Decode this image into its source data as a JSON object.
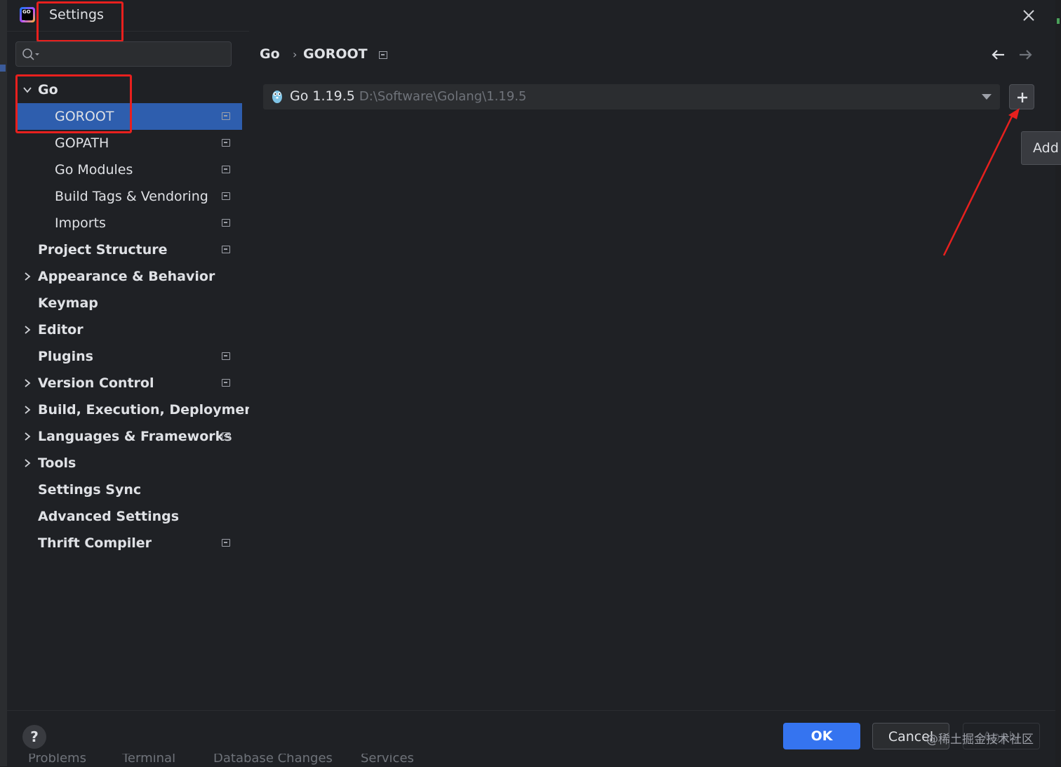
{
  "window": {
    "title": "Settings"
  },
  "search": {
    "placeholder": ""
  },
  "tree": {
    "items": [
      {
        "label": "Go",
        "level": 1,
        "expanded": true,
        "project_icon": false
      },
      {
        "label": "GOROOT",
        "level": 2,
        "selected": true,
        "project_icon": true
      },
      {
        "label": "GOPATH",
        "level": 2,
        "project_icon": true
      },
      {
        "label": "Go Modules",
        "level": 2,
        "project_icon": true
      },
      {
        "label": "Build Tags & Vendoring",
        "level": 2,
        "project_icon": true
      },
      {
        "label": "Imports",
        "level": 2,
        "project_icon": true
      },
      {
        "label": "Project Structure",
        "level": 1,
        "project_icon": true
      },
      {
        "label": "Appearance & Behavior",
        "level": 1,
        "collapsed": true
      },
      {
        "label": "Keymap",
        "level": 1
      },
      {
        "label": "Editor",
        "level": 1,
        "collapsed": true
      },
      {
        "label": "Plugins",
        "level": 1,
        "project_icon": true
      },
      {
        "label": "Version Control",
        "level": 1,
        "collapsed": true,
        "project_icon": true
      },
      {
        "label": "Build, Execution, Deployment",
        "level": 1,
        "collapsed": true
      },
      {
        "label": "Languages & Frameworks",
        "level": 1,
        "collapsed": true,
        "project_icon": true
      },
      {
        "label": "Tools",
        "level": 1,
        "collapsed": true
      },
      {
        "label": "Settings Sync",
        "level": 1
      },
      {
        "label": "Advanced Settings",
        "level": 1
      },
      {
        "label": "Thrift Compiler",
        "level": 1,
        "project_icon": true
      }
    ]
  },
  "breadcrumb": {
    "parent": "Go",
    "separator": "›",
    "current": "GOROOT"
  },
  "sdk": {
    "name": "Go 1.19.5",
    "path": "D:\\Software\\Golang\\1.19.5"
  },
  "add_tooltip": "Add",
  "footer": {
    "help": "?",
    "ok": "OK",
    "cancel": "Cancel",
    "apply": "Apply",
    "watermark": "@稀土掘金技术社区"
  },
  "tool_windows": [
    "Problems",
    "Terminal",
    "Database Changes",
    "Services"
  ],
  "colors": {
    "accent": "#3574f0",
    "selection": "#2e5eae",
    "annotation": "#e8201e",
    "background": "#1f2125"
  }
}
